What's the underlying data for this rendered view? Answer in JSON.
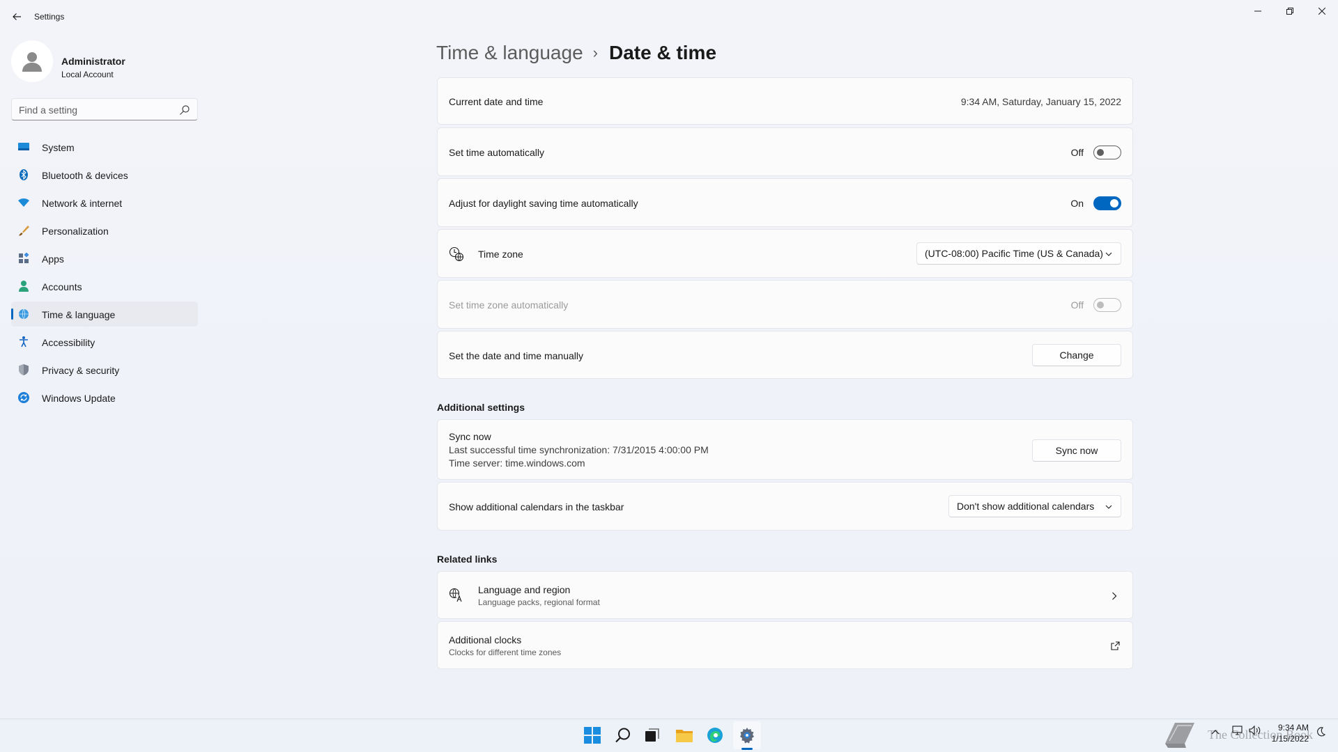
{
  "window": {
    "title": "Settings"
  },
  "profile": {
    "name": "Administrator",
    "account_type": "Local Account"
  },
  "search": {
    "placeholder": "Find a setting"
  },
  "nav": {
    "items": [
      {
        "label": "System",
        "icon": "monitor-icon",
        "color": "#0078d4"
      },
      {
        "label": "Bluetooth & devices",
        "icon": "bluetooth-icon",
        "color": "#0067c0"
      },
      {
        "label": "Network & internet",
        "icon": "wifi-icon",
        "color": "#0078d4"
      },
      {
        "label": "Personalization",
        "icon": "brush-icon",
        "color": "#c4802a"
      },
      {
        "label": "Apps",
        "icon": "apps-icon",
        "color": "#5b6c86"
      },
      {
        "label": "Accounts",
        "icon": "person-icon",
        "color": "#2aa37a"
      },
      {
        "label": "Time & language",
        "icon": "globe-clock-icon",
        "color": "#1f8ad2"
      },
      {
        "label": "Accessibility",
        "icon": "accessibility-icon",
        "color": "#1266c4"
      },
      {
        "label": "Privacy & security",
        "icon": "shield-icon",
        "color": "#6e7582"
      },
      {
        "label": "Windows Update",
        "icon": "update-icon",
        "color": "#1e7fd8"
      }
    ],
    "active_index": 6
  },
  "breadcrumb": {
    "parent": "Time & language",
    "separator": "›",
    "current": "Date & time"
  },
  "current_datetime": {
    "label": "Current date and time",
    "value": "9:34 AM, Saturday, January 15, 2022"
  },
  "set_time_auto": {
    "label": "Set time automatically",
    "state_label": "Off",
    "on": false
  },
  "daylight_saving": {
    "label": "Adjust for daylight saving time automatically",
    "state_label": "On",
    "on": true
  },
  "time_zone": {
    "label": "Time zone",
    "value": "(UTC-08:00) Pacific Time (US & Canada)"
  },
  "set_timezone_auto": {
    "label": "Set time zone automatically",
    "state_label": "Off",
    "on": false,
    "disabled": true
  },
  "manual_datetime": {
    "label": "Set the date and time manually",
    "button": "Change"
  },
  "additional_settings": {
    "title": "Additional settings",
    "sync": {
      "title": "Sync now",
      "last_sync": "Last successful time synchronization: 7/31/2015 4:00:00 PM",
      "server": "Time server: time.windows.com",
      "button": "Sync now"
    },
    "calendars": {
      "label": "Show additional calendars in the taskbar",
      "value": "Don't show additional calendars"
    }
  },
  "related_links": {
    "title": "Related links",
    "language_region": {
      "title": "Language and region",
      "subtitle": "Language packs, regional format"
    },
    "additional_clocks": {
      "title": "Additional clocks",
      "subtitle": "Clocks for different time zones"
    }
  },
  "taskbar": {
    "icons": [
      "windows-start-icon",
      "search-icon",
      "task-view-icon",
      "file-explorer-icon",
      "edge-icon",
      "settings-icon"
    ],
    "clock_time": "9:34 AM",
    "clock_date": "1/15/2022",
    "watermark": "The Collection Book"
  },
  "colors": {
    "accent": "#0067c0",
    "background": "#f3f4f9",
    "card": "#fbfbfc"
  }
}
